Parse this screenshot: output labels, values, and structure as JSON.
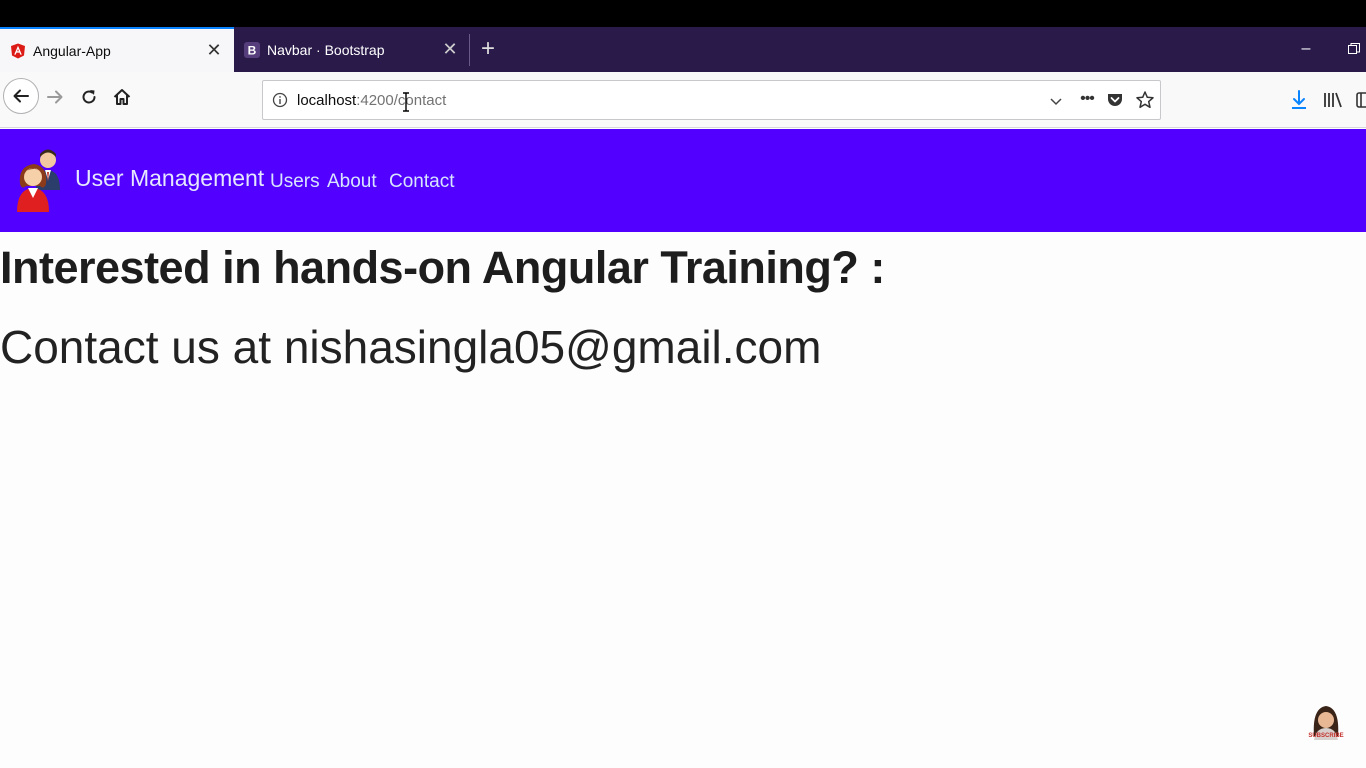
{
  "browser": {
    "tabs": [
      {
        "title": "Angular-App",
        "favicon": "angular-icon",
        "active": true
      },
      {
        "title": "Navbar · Bootstrap",
        "favicon": "bootstrap-icon",
        "active": false
      }
    ],
    "url": {
      "host": "localhost",
      "rest": ":4200/contact"
    }
  },
  "app": {
    "brand": "User Management",
    "nav": [
      {
        "label": "Users"
      },
      {
        "label": "About"
      },
      {
        "label": "Contact"
      }
    ],
    "navbar_color": "#5200ff"
  },
  "content": {
    "heading": "Interested in hands-on Angular Training? :",
    "text": "Contact us at nishasingla05@gmail.com"
  },
  "watermark": {
    "label": "SUBSCRIBE"
  }
}
